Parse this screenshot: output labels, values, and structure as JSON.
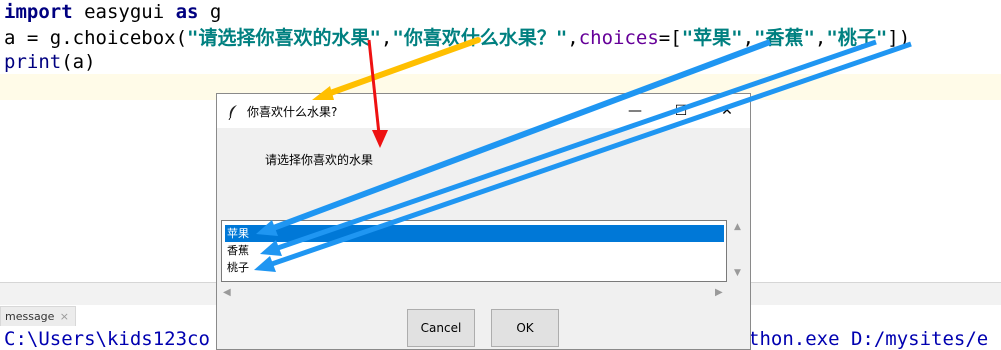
{
  "editor": {
    "line1": {
      "kw_import": "import",
      "module": " easygui ",
      "kw_as": "as",
      "alias": " g"
    },
    "line2": {
      "prefix": "a = g.choicebox(",
      "arg1": "\"请选择你喜欢的水果\"",
      "comma1": ",",
      "arg2": "\"你喜欢什么水果？\"",
      "comma2": ",",
      "kwarg": "choices",
      "eq": "=[",
      "choice1": "\"苹果\"",
      "comma3": ",",
      "choice2": "\"香蕉\"",
      "comma4": ",",
      "choice3": "\"桃子\"",
      "suffix": "])"
    },
    "line3": {
      "func": "print",
      "args": "(a)"
    }
  },
  "console": {
    "tab_label": "message",
    "tab_close": "×",
    "output_left": "C:\\Users\\kids123co",
    "output_right": "thon.exe D:/mysites/e"
  },
  "dialog": {
    "title": "你喜欢什么水果?",
    "message": "请选择你喜欢的水果",
    "choices": [
      "苹果",
      "香蕉",
      "桃子"
    ],
    "selected_index": 0,
    "cancel_label": "Cancel",
    "ok_label": "OK",
    "minimize_glyph": "—",
    "maximize_glyph": "☐",
    "close_glyph": "✕"
  },
  "colors": {
    "arrow_orange": "#ffbf00",
    "arrow_red": "#ee1111",
    "arrow_blue": "#1f96f2",
    "selection": "#0078d7"
  }
}
